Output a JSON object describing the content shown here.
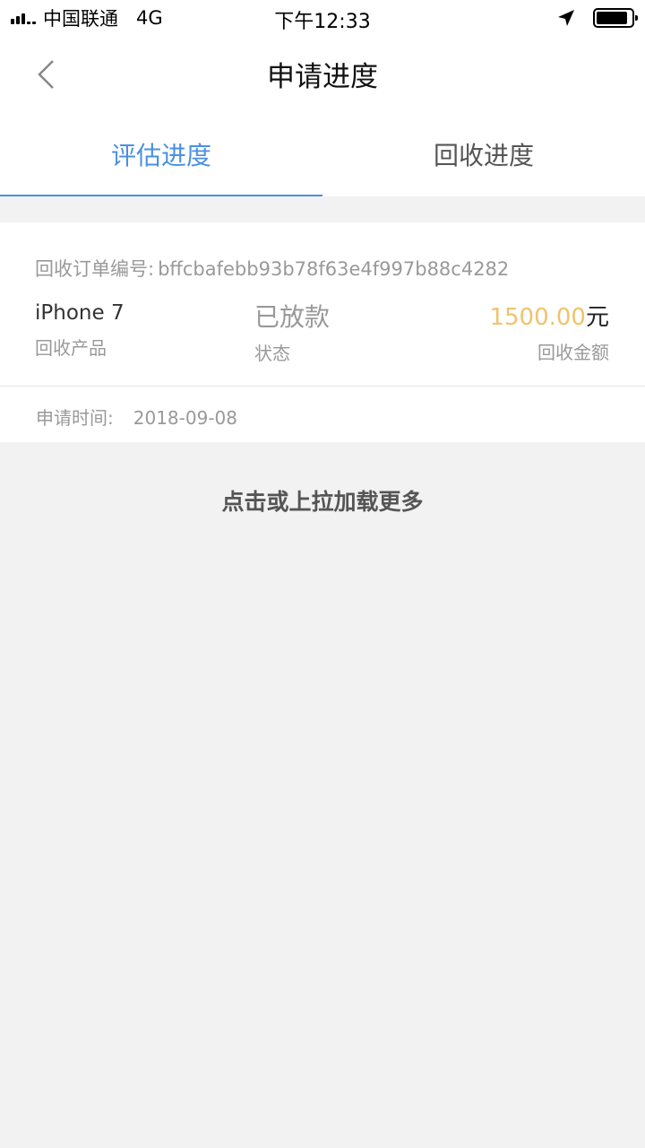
{
  "status_bar": {
    "carrier": "中国联通",
    "network": "4G",
    "time": "下午12:33",
    "battery_level": 0.9
  },
  "nav": {
    "title": "申请进度"
  },
  "tabs": [
    {
      "label": "评估进度",
      "active": true
    },
    {
      "label": "回收进度",
      "active": false
    }
  ],
  "order": {
    "order_label": "回收订单编号:",
    "order_id": "bffcbafebb93b78f63e4f997b88c4282",
    "product_value": "iPhone 7",
    "product_label": "回收产品",
    "status_value": "已放款",
    "status_label": "状态",
    "amount_value": "1500.00",
    "amount_unit": "元",
    "amount_label": "回收金额",
    "apply_label": "申请时间:",
    "apply_date": "2018-09-08"
  },
  "load_more": "点击或上拉加载更多",
  "colors": {
    "accent": "#4a90e2",
    "amount": "#f0c36b",
    "background": "#f2f2f2"
  }
}
